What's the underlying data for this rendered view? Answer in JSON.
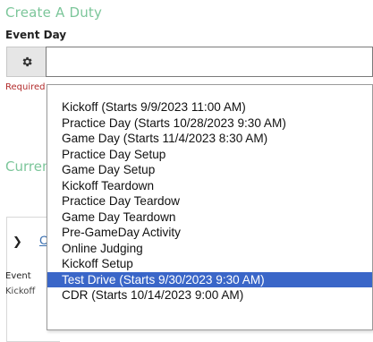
{
  "form": {
    "title": "Create A Duty",
    "event_day_label": "Event Day",
    "select_value": "",
    "required_text": "Required",
    "addon_icon": "gear-icon"
  },
  "current_section": {
    "heading": "Current",
    "panel_link": "C",
    "event_label": "Event",
    "event_value": "Kickoff"
  },
  "dropdown": {
    "options": [
      "Kickoff (Starts 9/9/2023 11:00 AM)",
      "Practice Day (Starts 10/28/2023 9:30 AM)",
      "Game Day (Starts 11/4/2023 8:30 AM)",
      "Practice Day Setup",
      "Game Day Setup",
      "Kickoff Teardown",
      "Practice Day Teardow",
      "Game Day Teardown",
      "Pre-GameDay Activity",
      "Online Judging",
      "Kickoff Setup",
      "Test Drive (Starts 9/30/2023 9:30 AM)",
      "CDR (Starts 10/14/2023 9:00 AM)"
    ],
    "selected": "Test Drive (Starts 9/30/2023 9:30 AM)"
  },
  "colors": {
    "heading_green": "#7cc69a",
    "selected_blue": "#3a66c8",
    "required_red": "#b22b2b"
  }
}
